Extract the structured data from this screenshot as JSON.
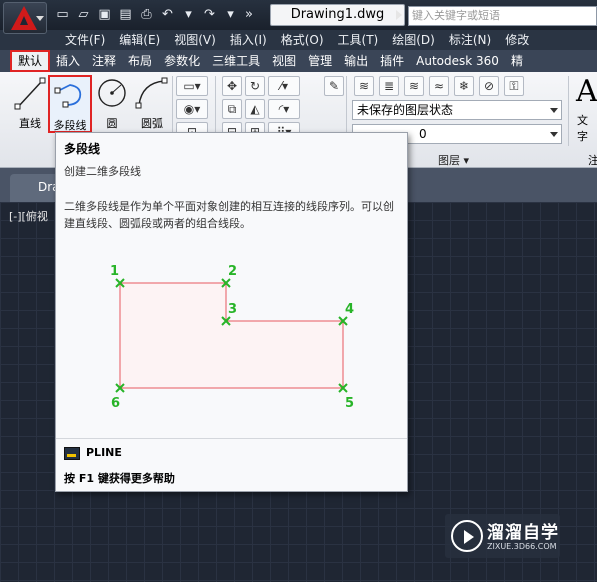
{
  "window": {
    "document_title": "Drawing1.dwg",
    "search_placeholder": "键入关键字或短语"
  },
  "menu": [
    "文件(F)",
    "编辑(E)",
    "视图(V)",
    "插入(I)",
    "格式(O)",
    "工具(T)",
    "绘图(D)",
    "标注(N)",
    "修改"
  ],
  "ribbon_tabs": [
    "默认",
    "插入",
    "注释",
    "布局",
    "参数化",
    "三维工具",
    "视图",
    "管理",
    "输出",
    "插件",
    "Autodesk 360",
    "精"
  ],
  "ribbon": {
    "draw_tools": [
      {
        "label": "直线",
        "icon": "line-icon"
      },
      {
        "label": "多段线",
        "icon": "polyline-icon"
      },
      {
        "label": "圆",
        "icon": "circle-icon"
      },
      {
        "label": "圆弧",
        "icon": "arc-icon"
      }
    ],
    "layer_state": "未保存的图层状态",
    "layer_current": "0",
    "panel_layers": "图层",
    "text_tool": "文字",
    "panel_note": "注"
  },
  "file_tab": "Dra",
  "viewport_label": "[-][俯视",
  "tooltip": {
    "title": "多段线",
    "subtitle": "创建二维多段线",
    "description": "二维多段线是作为单个平面对象创建的相互连接的线段序列。可以创建直线段、圆弧段或两者的组合线段。",
    "points": [
      "1",
      "2",
      "3",
      "4",
      "5",
      "6"
    ],
    "command": "PLINE",
    "help": "按 F1 键获得更多帮助"
  },
  "watermark": {
    "name": "溜溜自学",
    "url": "ZIXUE.3D66.COM"
  },
  "colors": {
    "accent_red": "#e02424",
    "point_green": "#28b428",
    "shape_line": "#e8585f"
  }
}
